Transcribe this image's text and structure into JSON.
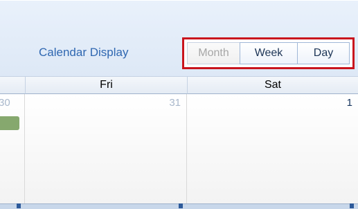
{
  "header": {
    "display_label": "Calendar Display",
    "views": {
      "month": "Month",
      "week": "Week",
      "day": "Day"
    }
  },
  "grid": {
    "day_headers": [
      "",
      "Fri",
      "Sat"
    ],
    "dates": {
      "left": "30",
      "fri": "31",
      "sat": "1"
    }
  },
  "colors": {
    "accent": "#2f67b1",
    "highlight_border": "#c9141d",
    "event": "#86a86e"
  }
}
